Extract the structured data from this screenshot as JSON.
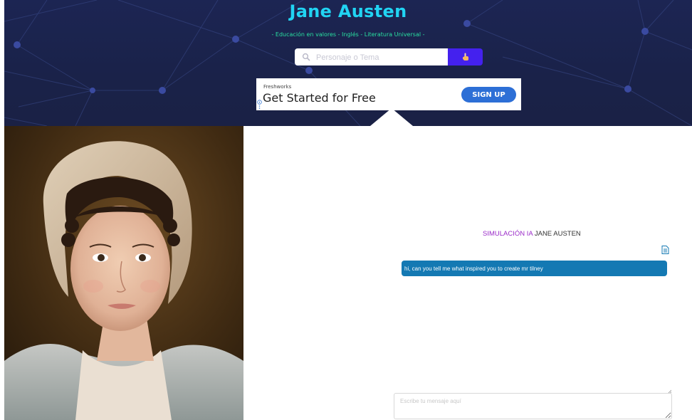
{
  "header": {
    "title": "Jane Austen",
    "subjects": "- Educación en valores - Inglés - Literatura Universal -"
  },
  "search": {
    "placeholder": "Personaje o Tema",
    "icon": "search-icon",
    "button_icon": "hand-pointer-icon"
  },
  "ad": {
    "brand": "Freshworks",
    "headline": "Get Started for Free",
    "cta": "SIGN UP"
  },
  "portrait": {
    "icon": "portrait-image"
  },
  "chat": {
    "title_highlight": "SIMULACIÓN IA",
    "title_name": "JANE AUSTEN",
    "messages": [
      {
        "role": "user",
        "text": "hi, can you tell me what inspired you to create mr tilney"
      }
    ],
    "input_placeholder": "Escribe tu mensaje aquí"
  },
  "colors": {
    "header_bg": "#1c2553",
    "title": "#21d4f3",
    "subjects": "#29e0a0",
    "search_button": "#4421ee",
    "ad_cta": "#2d6fd6",
    "chat_highlight": "#9a2bc8",
    "bubble": "#1479b3"
  }
}
